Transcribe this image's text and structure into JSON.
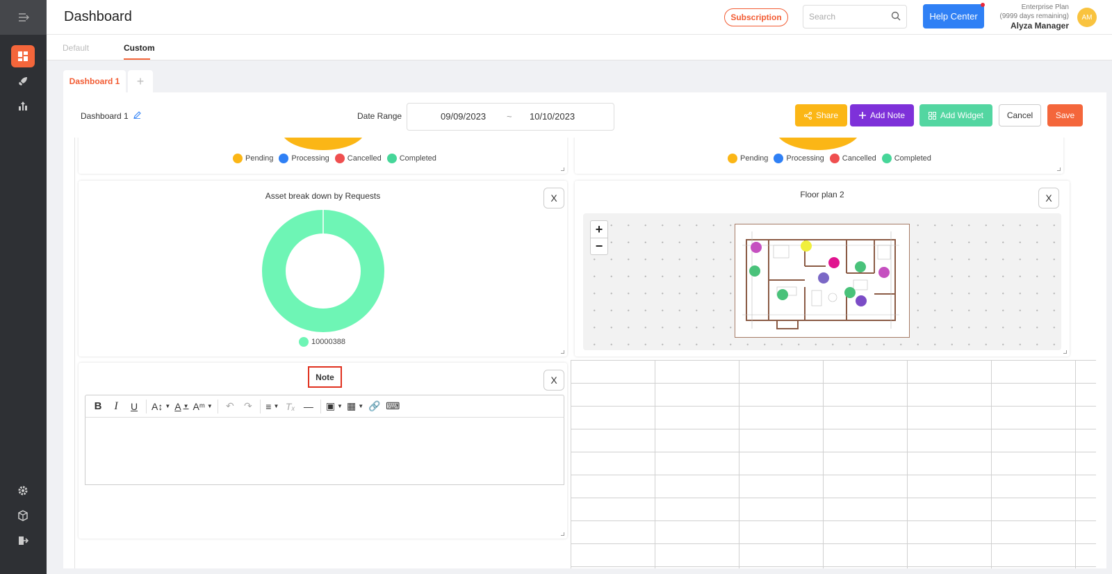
{
  "header": {
    "title": "Dashboard",
    "subscription_label": "Subscription",
    "search_placeholder": "Search",
    "help_label": "Help Center",
    "plan_name": "Enterprise Plan",
    "plan_remaining": "(9999 days remaining)",
    "user_name": "Alyza Manager",
    "avatar_initials": "AM"
  },
  "tabs": [
    {
      "label": "Default",
      "active": false
    },
    {
      "label": "Custom",
      "active": true
    }
  ],
  "dashboard_tabs": {
    "active_label": "Dashboard 1",
    "add_label": "+"
  },
  "toolbar": {
    "dashboard_name": "Dashboard 1",
    "date_range_label": "Date Range",
    "date_from": "09/09/2023",
    "date_sep": "~",
    "date_to": "10/10/2023",
    "share_label": "Share",
    "add_note_label": "Add Note",
    "add_widget_label": "Add Widget",
    "cancel_label": "Cancel",
    "save_label": "Save"
  },
  "status_legend": [
    {
      "label": "Pending",
      "color": "#fbb616"
    },
    {
      "label": "Processing",
      "color": "#2f80f5"
    },
    {
      "label": "Cancelled",
      "color": "#ef4f4f"
    },
    {
      "label": "Completed",
      "color": "#46d699"
    }
  ],
  "widgets": {
    "asset_title": "Asset break down by Requests",
    "asset_legend": "10000388",
    "floor_title": "Floor plan 2",
    "note_title": "Note",
    "close_label": "X",
    "zoom_in": "+",
    "zoom_out": "−"
  },
  "chart_data": {
    "type": "pie",
    "title": "Asset break down by Requests",
    "categories": [
      "10000388"
    ],
    "values": [
      1
    ],
    "colors": [
      "#6ef5b5"
    ]
  },
  "colors": {
    "accent": "#f4663b",
    "sidebar": "#2e3034"
  }
}
